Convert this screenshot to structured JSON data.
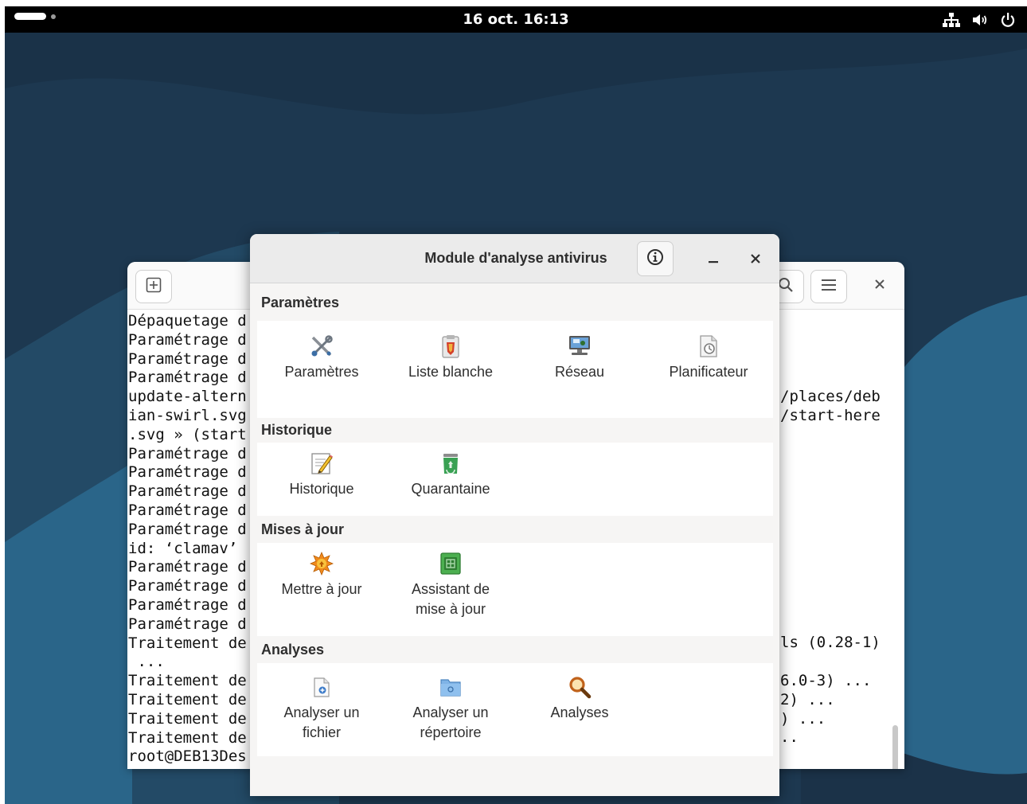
{
  "topbar": {
    "clock": "16 oct.  16:13",
    "icons": [
      "network-icon",
      "volume-icon",
      "power-icon"
    ]
  },
  "terminal": {
    "icons": [
      "new-tab-icon",
      "search-icon",
      "menu-icon",
      "close-icon"
    ],
    "left_lines": [
      "Dépaquetage d",
      "Paramétrage d",
      "Paramétrage d",
      "Paramétrage d",
      "update-altern",
      "ian-swirl.svg",
      ".svg » (start",
      "Paramétrage d",
      "Paramétrage d",
      "Paramétrage d",
      "Paramétrage d",
      "Paramétrage d",
      "id: ‘clamav’",
      "Paramétrage d",
      "Paramétrage d",
      "Paramétrage d",
      "Paramétrage d",
      "Traitement de",
      " ...",
      "Traitement de",
      "Traitement de",
      "Traitement de",
      "Traitement de",
      "root@DEB13Des"
    ],
    "right_lines": [
      {
        "row": 4,
        "text": "/places/deb"
      },
      {
        "row": 5,
        "text": "/start-here"
      },
      {
        "row": 17,
        "text": "ls (0.28-1)"
      },
      {
        "row": 19,
        "text": "6.0-3) ..."
      },
      {
        "row": 20,
        "text": "2) ..."
      },
      {
        "row": 21,
        "text": ") ..."
      },
      {
        "row": 22,
        "text": ".."
      }
    ]
  },
  "clamtk": {
    "title": "Module d'analyse antivirus",
    "about_icon": "info-icon",
    "sections": [
      {
        "title": "Paramètres",
        "items": [
          {
            "label": "Paramètres",
            "icon": "tools-icon"
          },
          {
            "label": "Liste blanche",
            "icon": "whitelist-icon"
          },
          {
            "label": "Réseau",
            "icon": "network-computer-icon"
          },
          {
            "label": "Planificateur",
            "icon": "scheduler-icon"
          }
        ]
      },
      {
        "title": "Historique",
        "items": [
          {
            "label": "Historique",
            "icon": "history-edit-icon"
          },
          {
            "label": "Quarantaine",
            "icon": "quarantine-bin-icon"
          }
        ]
      },
      {
        "title": "Mises à jour",
        "items": [
          {
            "label": "Mettre à jour",
            "icon": "update-starburst-icon"
          },
          {
            "label": "Assistant de\nmise à jour",
            "icon": "update-assistant-icon"
          }
        ]
      },
      {
        "title": "Analyses",
        "items": [
          {
            "label": "Analyser un\nfichier",
            "icon": "scan-file-icon"
          },
          {
            "label": "Analyser un\nrépertoire",
            "icon": "scan-folder-icon"
          },
          {
            "label": "Analyses",
            "icon": "magnifier-icon"
          }
        ]
      }
    ]
  },
  "colors": {
    "wallpaper_dark": "#1f3a52",
    "wallpaper_light": "#2b6a8f",
    "window_bg": "#f6f5f4",
    "panel_bg": "#ffffff"
  }
}
